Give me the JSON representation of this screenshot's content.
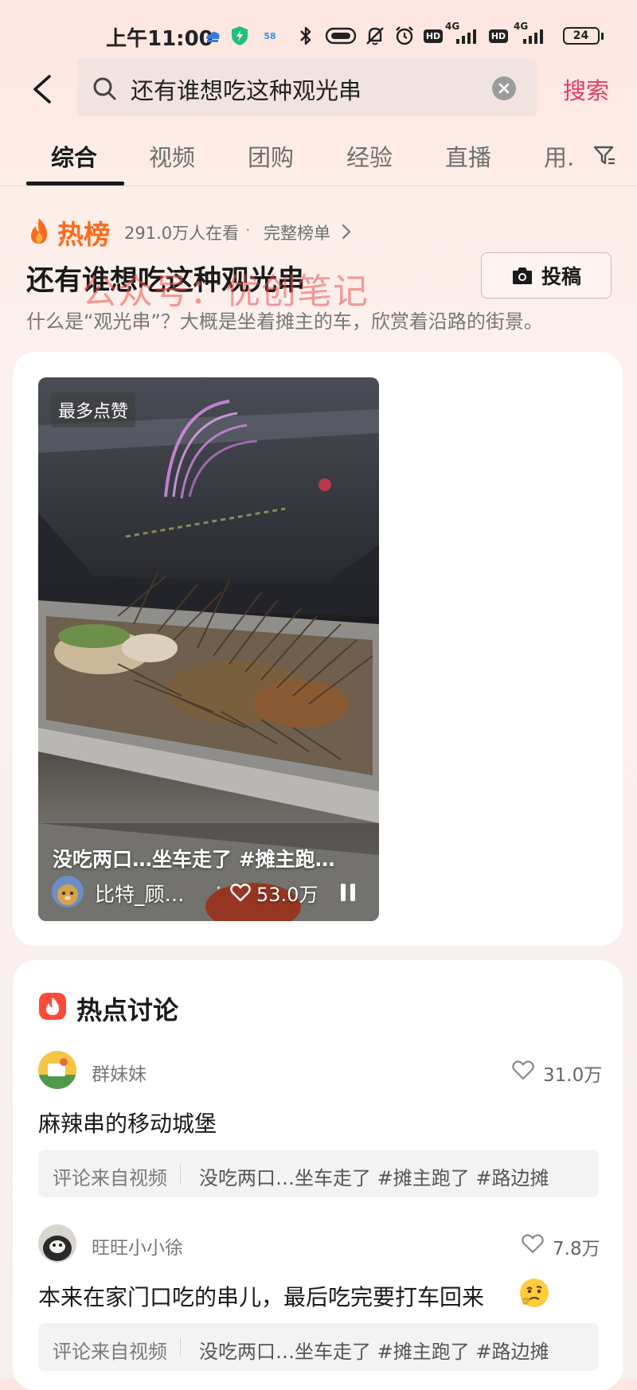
{
  "status_bar": {
    "time": "上午11:00",
    "network_1": "4G",
    "network_2": "4G",
    "hd": "HD",
    "battery": "24",
    "small_icon_text": "58"
  },
  "search": {
    "query": "还有谁想吃这种观光串",
    "button_label": "搜索"
  },
  "tabs": [
    {
      "label": "综合",
      "active": true
    },
    {
      "label": "视频"
    },
    {
      "label": "团购"
    },
    {
      "label": "经验"
    },
    {
      "label": "直播"
    },
    {
      "label": "用."
    }
  ],
  "hot_list": {
    "title": "热榜",
    "viewers": "291.0万人在看",
    "separator": "·",
    "full_list_label": "完整榜单"
  },
  "topic": {
    "title": "还有谁想吃这种观光串",
    "description": "什么是“观光串”？大概是坐着摊主的车，欣赏着沿路的街景。",
    "post_button_label": "投稿",
    "watermark": "公众号：优创笔记"
  },
  "video": {
    "badge": "最多点赞",
    "caption": "没吃两口…坐车走了 #摊主跑…",
    "author": "比特_顾…",
    "separator": "·",
    "likes": "53.0万"
  },
  "discussion": {
    "title": "热点讨论",
    "comments": [
      {
        "user": "群妹妹",
        "likes": "31.0万",
        "text": "麻辣串的移动城堡",
        "source_label": "评论来自视频",
        "source_title": "没吃两口…坐车走了 #摊主跑了 #路边摊"
      },
      {
        "user": "旺旺小小徐",
        "likes": "7.8万",
        "text": "本来在家门口吃的串儿，最后吃完要打车回来",
        "source_label": "评论来自视频",
        "source_title": "没吃两口…坐车走了 #摊主跑了 #路边摊"
      }
    ]
  },
  "colors": {
    "accent": "#e53c5e",
    "hot_orange": "#ff6a1a"
  }
}
